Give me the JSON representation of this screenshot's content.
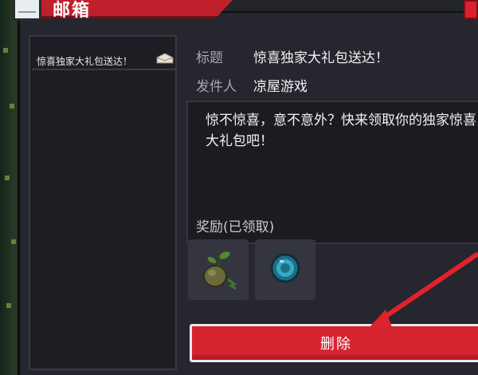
{
  "window": {
    "title": "邮箱"
  },
  "mail_list": {
    "items": [
      {
        "subject": "惊喜独家大礼包送达！",
        "icon": "envelope-open-icon"
      }
    ]
  },
  "mail_detail": {
    "title_label": "标题",
    "title_value": "惊喜独家大礼包送达！",
    "sender_label": "发件人",
    "sender_value": "凉屋游戏",
    "body": "惊不惊喜，意不意外？快来领取你的独家惊喜大礼包吧！",
    "rewards_label": "奖励(已领取)",
    "rewards": [
      {
        "icon": "seed-sprout-icon"
      },
      {
        "icon": "blue-orb-icon"
      }
    ],
    "delete_label": "删除"
  },
  "colors": {
    "accent_red": "#d52430",
    "panel_bg": "#26262e",
    "annotation_arrow": "#e0222e"
  }
}
